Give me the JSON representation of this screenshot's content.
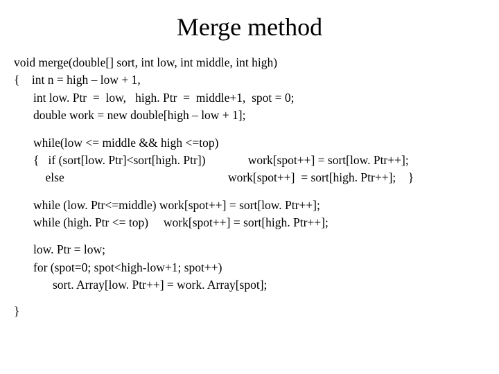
{
  "title": "Merge method",
  "block1": {
    "l1": "void merge(double[] sort, int low, int middle, int high)",
    "l2": "{    int n = high – low + 1,",
    "l3": "int low. Ptr  =  low,   high. Ptr  =  middle+1,  spot = 0;",
    "l4": "double work = new double[high – low + 1];"
  },
  "block2": {
    "l1": "while(low <= middle && high <=top)",
    "l2": "{   if (sort[low. Ptr]<sort[high. Ptr])              work[spot++] = sort[low. Ptr++];",
    "l3": "    else                                                      work[spot++]  = sort[high. Ptr++];    }"
  },
  "block3": {
    "l1": "while (low. Ptr<=middle) work[spot++] = sort[low. Ptr++];",
    "l2": "while (high. Ptr <= top)     work[spot++] = sort[high. Ptr++];"
  },
  "block4": {
    "l1": "low. Ptr = low;",
    "l2": "for (spot=0; spot<high-low+1; spot++)",
    "l3": "sort. Array[low. Ptr++] = work. Array[spot];"
  },
  "closebrace": "}"
}
